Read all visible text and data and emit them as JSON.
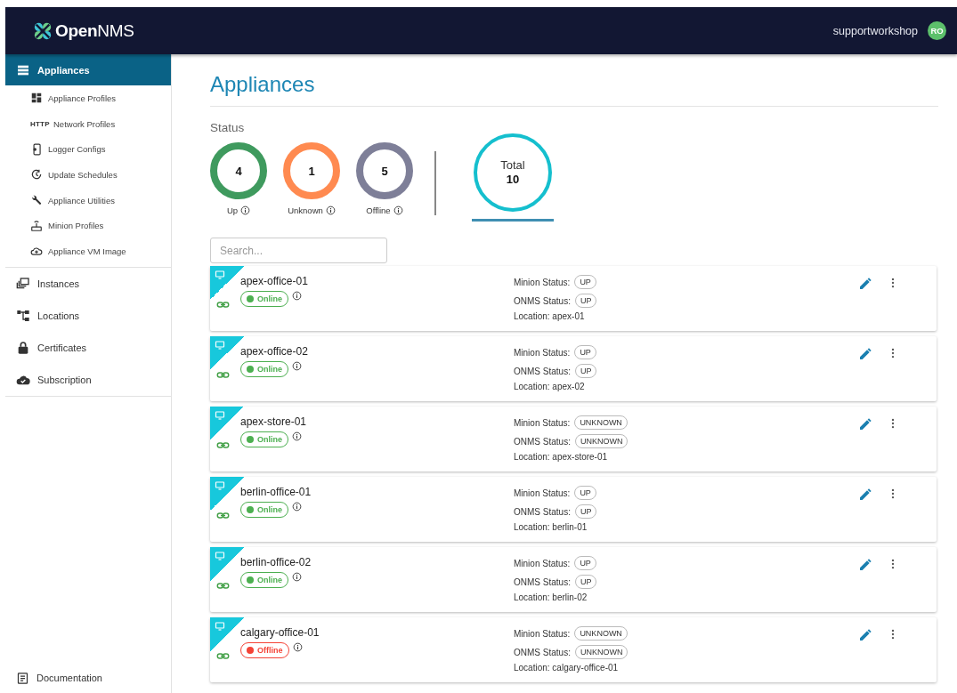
{
  "header": {
    "logo": "**Open**NMS",
    "user": "supportworkshop",
    "avatar": "RO"
  },
  "sidebar": {
    "items": [
      {
        "label": "Appliances",
        "selected": true,
        "children": [
          {
            "label": "Appliance Profiles",
            "selected": false
          },
          {
            "label": "Network Profiles",
            "selected": false,
            "icon_text": "HTTP"
          },
          {
            "label": "Logger Configs",
            "selected": false
          },
          {
            "label": "Update Schedules",
            "selected": false
          },
          {
            "label": "Appliance Utilities",
            "selected": false
          },
          {
            "label": "Minion Profiles",
            "selected": false
          },
          {
            "label": "Appliance VM Image",
            "selected": false
          }
        ]
      },
      {
        "label": "Instances",
        "selected": false
      },
      {
        "label": "Locations",
        "selected": false
      },
      {
        "label": "Certificates",
        "selected": false
      },
      {
        "label": "Subscription",
        "selected": false
      }
    ],
    "footer": "Documentation"
  },
  "page": {
    "title": "Appliances",
    "status_heading": "Status",
    "stats": [
      {
        "label": "Up",
        "value": "4",
        "color": "#3f9a5e",
        "selected": false
      },
      {
        "label": "Unknown",
        "value": "1",
        "color": "#ff8a50",
        "selected": false
      },
      {
        "label": "Offline",
        "value": "5",
        "color": "#7e7f98",
        "selected": false
      }
    ],
    "total": {
      "label": "Total",
      "value": "10",
      "selected": true
    },
    "search": {
      "placeholder": "Search..."
    },
    "appliances": [
      {
        "name": "apex-office-01",
        "status": {
          "kind": "online",
          "label": "Online"
        },
        "minion_label": "Minion Status:",
        "minion": "UP",
        "onms_label": "ONMS Status:",
        "onms": "UP",
        "location": "Location: apex-01"
      },
      {
        "name": "apex-office-02",
        "status": {
          "kind": "online",
          "label": "Online"
        },
        "minion_label": "Minion Status:",
        "minion": "UP",
        "onms_label": "ONMS Status:",
        "onms": "UP",
        "location": "Location: apex-02"
      },
      {
        "name": "apex-store-01",
        "status": {
          "kind": "online",
          "label": "Online"
        },
        "minion_label": "Minion Status:",
        "minion": "UNKNOWN",
        "onms_label": "ONMS Status:",
        "onms": "UNKNOWN",
        "location": "Location: apex-store-01"
      },
      {
        "name": "berlin-office-01",
        "status": {
          "kind": "online",
          "label": "Online"
        },
        "minion_label": "Minion Status:",
        "minion": "UP",
        "onms_label": "ONMS Status:",
        "onms": "UP",
        "location": "Location: berlin-01"
      },
      {
        "name": "berlin-office-02",
        "status": {
          "kind": "online",
          "label": "Online"
        },
        "minion_label": "Minion Status:",
        "minion": "UP",
        "onms_label": "ONMS Status:",
        "onms": "UP",
        "location": "Location: berlin-02"
      },
      {
        "name": "calgary-office-01",
        "status": {
          "kind": "offline",
          "label": "Offline"
        },
        "minion_label": "Minion Status:",
        "minion": "UNKNOWN",
        "onms_label": "ONMS Status:",
        "onms": "UNKNOWN",
        "location": "Location: calgary-office-01"
      }
    ]
  }
}
